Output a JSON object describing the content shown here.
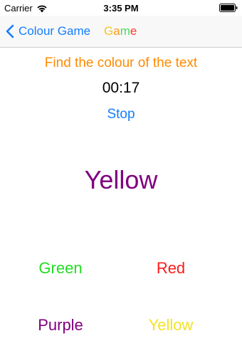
{
  "status_bar": {
    "carrier": "Carrier",
    "time": "3:35 PM",
    "icons": [
      "wifi-icon",
      "battery-icon"
    ]
  },
  "nav": {
    "back_label": "Colour Game",
    "back_icon": "chevron-left-icon",
    "title_letters": [
      {
        "char": "G",
        "color": "#f5c518"
      },
      {
        "char": "a",
        "color": "#f59a23"
      },
      {
        "char": "m",
        "color": "#4cd964"
      },
      {
        "char": "e",
        "color": "#ff3b30"
      }
    ]
  },
  "game": {
    "instruction": "Find the colour of the text",
    "instruction_color": "#ff8a00",
    "timer": "00:17",
    "stop_label": "Stop",
    "word": "Yellow",
    "word_color": "#800080",
    "answers": [
      {
        "label": "Green",
        "color": "#22dd22"
      },
      {
        "label": "Red",
        "color": "#ff1a1a"
      },
      {
        "label": "Purple",
        "color": "#800080"
      },
      {
        "label": "Yellow",
        "color": "#f2e427"
      }
    ]
  },
  "colors": {
    "accent": "#147efb",
    "nav_background": "#f8f8f8"
  }
}
